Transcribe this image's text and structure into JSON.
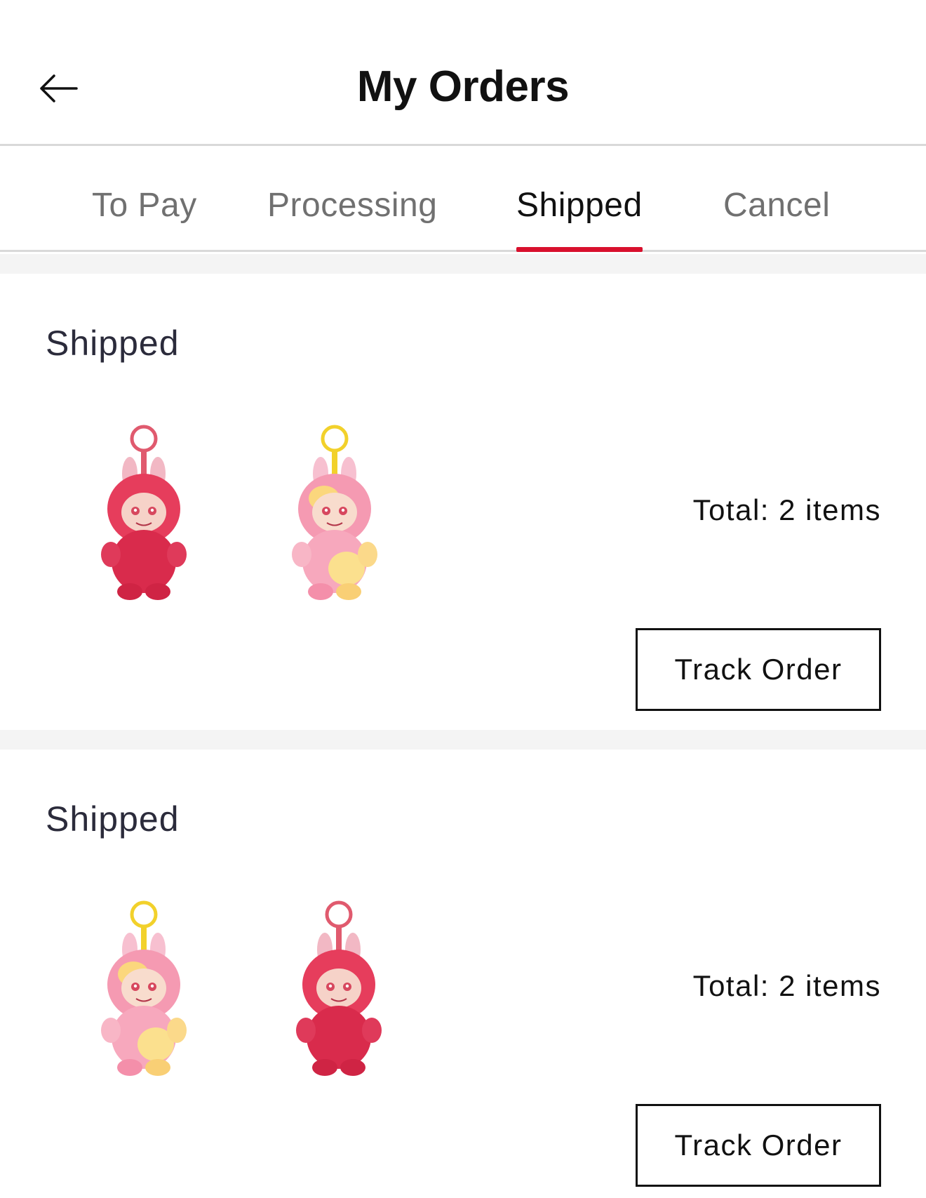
{
  "header": {
    "title": "My Orders",
    "back_icon": "arrow-left-icon"
  },
  "tabs": [
    {
      "label": "To Pay",
      "active": false
    },
    {
      "label": "Processing",
      "active": false
    },
    {
      "label": "Shipped",
      "active": true
    },
    {
      "label": "Cancel",
      "active": false
    }
  ],
  "colors": {
    "accent": "#d8102d",
    "divider": "#f4f4f4",
    "border": "#d9d9d9"
  },
  "orders": [
    {
      "status": "Shipped",
      "items": [
        {
          "name": "plush-keychain",
          "variant": "red",
          "icon": "plush-doll-icon"
        },
        {
          "name": "plush-keychain",
          "variant": "pink-yellow",
          "icon": "plush-doll-icon"
        }
      ],
      "total": "Total: 2 items",
      "action": "Track Order"
    },
    {
      "status": "Shipped",
      "items": [
        {
          "name": "plush-keychain",
          "variant": "pink-yellow",
          "icon": "plush-doll-icon"
        },
        {
          "name": "plush-keychain",
          "variant": "red",
          "icon": "plush-doll-icon"
        }
      ],
      "total": "Total: 2 items",
      "action": "Track Order"
    }
  ]
}
